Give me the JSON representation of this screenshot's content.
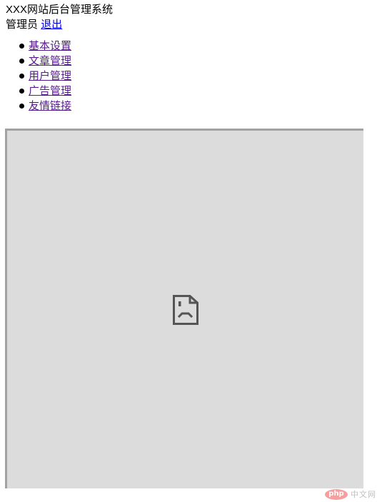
{
  "header": {
    "site_title": "XXX网站后台管理系统",
    "user_name": "管理员",
    "logout_label": "退出"
  },
  "nav": {
    "items": [
      {
        "label": "基本设置"
      },
      {
        "label": "文章管理"
      },
      {
        "label": "用户管理"
      },
      {
        "label": "广告管理"
      },
      {
        "label": "友情链接"
      }
    ]
  },
  "content": {
    "broken_image_icon": "broken-image-icon",
    "background_color": "#dcdcdc",
    "border_color": "#a2a2a2"
  },
  "watermark": {
    "badge_text": "php",
    "site_text": "中文网",
    "badge_color": "#f4908f"
  },
  "colors": {
    "link_new": "#0000ee",
    "link_visited": "#551a8b",
    "text": "#000000"
  }
}
